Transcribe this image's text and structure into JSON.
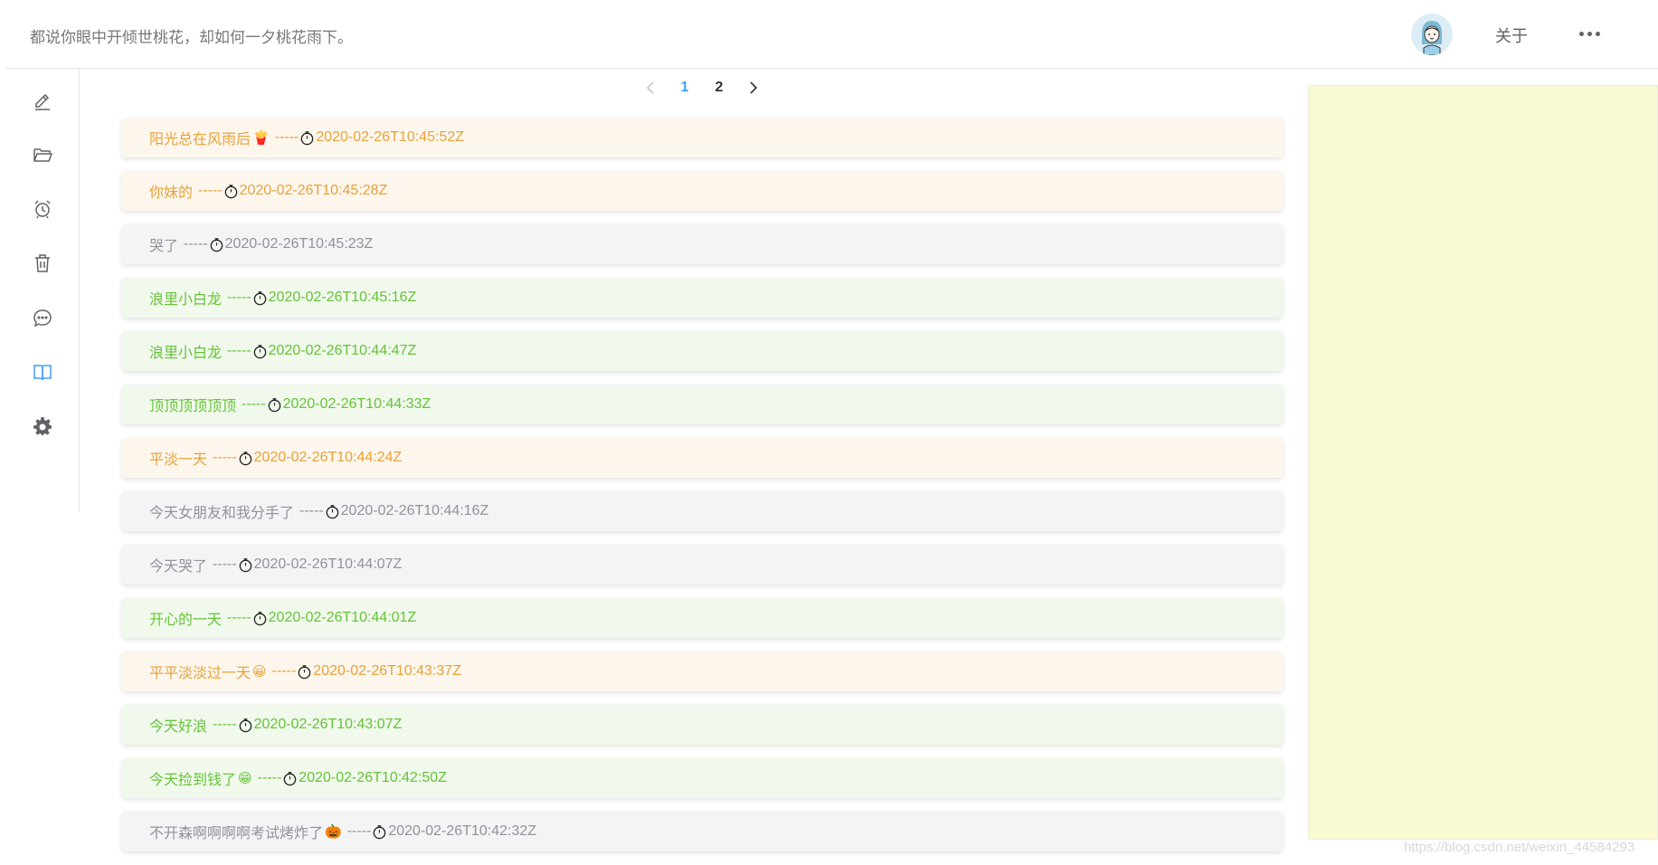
{
  "header": {
    "motto": "都说你眼中开倾世桃花，却如何一夕桃花雨下。",
    "about_label": "关于"
  },
  "sidebar": {
    "items": [
      {
        "icon": "edit-icon"
      },
      {
        "icon": "folder-open-icon"
      },
      {
        "icon": "alarm-clock-icon"
      },
      {
        "icon": "trash-icon"
      },
      {
        "icon": "chat-bubble-icon"
      },
      {
        "icon": "book-icon",
        "active": true
      },
      {
        "icon": "gear-icon"
      }
    ]
  },
  "pagination": {
    "pages": [
      "1",
      "2"
    ],
    "current": "1",
    "prev_disabled": true
  },
  "diary": {
    "separator": "-----",
    "entries": [
      {
        "title": "阳光总在风雨后",
        "emoji": "🍟",
        "time": "2020-02-26T10:45:52Z",
        "type": "warning"
      },
      {
        "title": "你妹的",
        "emoji": "",
        "time": "2020-02-26T10:45:28Z",
        "type": "warning"
      },
      {
        "title": "哭了",
        "emoji": "",
        "time": "2020-02-26T10:45:23Z",
        "type": "info"
      },
      {
        "title": "浪里小白龙",
        "emoji": "",
        "time": "2020-02-26T10:45:16Z",
        "type": "success"
      },
      {
        "title": "浪里小白龙",
        "emoji": "",
        "time": "2020-02-26T10:44:47Z",
        "type": "success"
      },
      {
        "title": "顶顶顶顶顶顶",
        "emoji": "",
        "time": "2020-02-26T10:44:33Z",
        "type": "success"
      },
      {
        "title": "平淡一天",
        "emoji": "",
        "time": "2020-02-26T10:44:24Z",
        "type": "warning"
      },
      {
        "title": "今天女朋友和我分手了",
        "emoji": "",
        "time": "2020-02-26T10:44:16Z",
        "type": "info"
      },
      {
        "title": "今天哭了",
        "emoji": "",
        "time": "2020-02-26T10:44:07Z",
        "type": "info"
      },
      {
        "title": "开心的一天",
        "emoji": "",
        "time": "2020-02-26T10:44:01Z",
        "type": "success"
      },
      {
        "title": "平平淡淡过一天",
        "emoji": "😀",
        "time": "2020-02-26T10:43:37Z",
        "type": "warning"
      },
      {
        "title": "今天好浪",
        "emoji": "",
        "time": "2020-02-26T10:43:07Z",
        "type": "success"
      },
      {
        "title": "今天捡到钱了",
        "emoji": "😁",
        "time": "2020-02-26T10:42:50Z",
        "type": "success"
      },
      {
        "title": "不开森啊啊啊啊考试烤炸了",
        "emoji": "🎃",
        "time": "2020-02-26T10:42:32Z",
        "type": "info"
      }
    ]
  },
  "watermark": "https://blog.csdn.net/weixin_44584293",
  "colors": {
    "warning": "#e6a23c",
    "info": "#909399",
    "success": "#67c23a",
    "primary": "#409eff",
    "panel": "#fafad2"
  }
}
